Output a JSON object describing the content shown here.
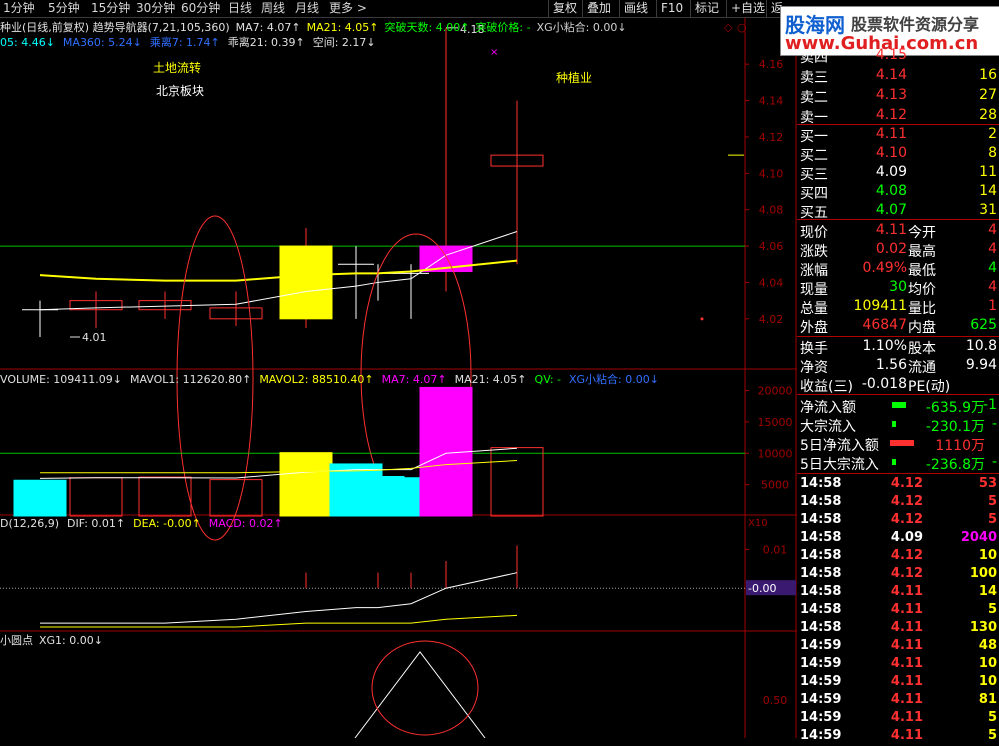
{
  "toolbar": {
    "periods": [
      "1分钟",
      "5分钟",
      "15分钟",
      "30分钟",
      "60分钟",
      "日线",
      "周线",
      "月线",
      "更多 >"
    ],
    "right_buttons": [
      "复权",
      "叠加",
      "画线",
      "F10",
      "标记",
      "+自选",
      "返"
    ]
  },
  "watermark": {
    "title": "股海网",
    "subtitle": "股票软件资源分享",
    "url": "www.Guhai.com.cn"
  },
  "kline": {
    "info_line1": [
      {
        "text": "种业(日线,前复权) 趋势导航器(7,21,105,360)",
        "color": "#e0e0e0"
      },
      {
        "text": "MA7: 4.07↑",
        "color": "#e0e0e0"
      },
      {
        "text": "MA21: 4.05↑",
        "color": "#ffff00"
      },
      {
        "text": "突破天数: 4.00↑",
        "color": "#00ff00"
      },
      {
        "text": "突破价格: -",
        "color": "#00ff00"
      },
      {
        "text": "XG小粘合: 0.00↓",
        "color": "#d0d0d0"
      }
    ],
    "info_line2": [
      {
        "text": "05: 4.46↓",
        "color": "#00ffff"
      },
      {
        "text": "MA360: 5.24↓",
        "color": "#3070ff"
      },
      {
        "text": "乘离7: 1.74↑",
        "color": "#3070ff"
      },
      {
        "text": "乖离21: 0.39↑",
        "color": "#e0e0e0"
      },
      {
        "text": "空间: 2.17↓",
        "color": "#e0e0e0"
      }
    ],
    "annotations": [
      {
        "text": "土地流转",
        "color": "#ffff00"
      },
      {
        "text": "北京板块",
        "color": "#ffffff"
      },
      {
        "text": "种植业",
        "color": "#ffff00"
      }
    ],
    "high_label": "4.18",
    "low_label": "4.01",
    "axis_ticks": [
      "4.16",
      "4.14",
      "4.12",
      "4.10",
      "4.08",
      "4.06",
      "4.04",
      "4.02"
    ]
  },
  "volume": {
    "info": [
      {
        "text": "VOLUME: 109411.09↓",
        "color": "#e0e0e0"
      },
      {
        "text": "MAVOL1: 112620.80↑",
        "color": "#e0e0e0"
      },
      {
        "text": "MAVOL2: 88510.40↑",
        "color": "#ffff00"
      },
      {
        "text": "MA7: 4.07↑",
        "color": "#ff00ff"
      },
      {
        "text": "MA21: 4.05↑",
        "color": "#e0e0e0"
      },
      {
        "text": "QV: -",
        "color": "#00ff00"
      },
      {
        "text": "XG小粘合: 0.00↓",
        "color": "#3070ff"
      }
    ],
    "axis_ticks": [
      "20000",
      "15000",
      "10000",
      "5000"
    ],
    "unit": "X10"
  },
  "macd": {
    "info": [
      {
        "text": "D(12,26,9)",
        "color": "#e0e0e0"
      },
      {
        "text": "DIF: 0.01↑",
        "color": "#e0e0e0"
      },
      {
        "text": "DEA: -0.00↑",
        "color": "#ffff00"
      },
      {
        "text": "MACD: 0.02↑",
        "color": "#ff00ff"
      }
    ],
    "axis_tick": "0.01",
    "current": "-0.00"
  },
  "xg": {
    "info": [
      {
        "text": "小圆点",
        "color": "#e0e0e0"
      },
      {
        "text": "XG1: 0.00↓",
        "color": "#e0e0e0"
      }
    ],
    "axis_tick": "0.50"
  },
  "quote": {
    "sell": [
      {
        "label": "卖四",
        "price": "4.15",
        "vol": ""
      },
      {
        "label": "卖三",
        "price": "4.14",
        "vol": "16"
      },
      {
        "label": "卖二",
        "price": "4.13",
        "vol": "27"
      },
      {
        "label": "卖一",
        "price": "4.12",
        "vol": "28"
      }
    ],
    "buy": [
      {
        "label": "买一",
        "price": "4.11",
        "pcolor": "#ff3030",
        "vol": "2"
      },
      {
        "label": "买二",
        "price": "4.10",
        "pcolor": "#ff3030",
        "vol": "8"
      },
      {
        "label": "买三",
        "price": "4.09",
        "pcolor": "#ffffff",
        "vol": "11"
      },
      {
        "label": "买四",
        "price": "4.08",
        "pcolor": "#00ff00",
        "vol": "14"
      },
      {
        "label": "买五",
        "price": "4.07",
        "pcolor": "#00ff00",
        "vol": "31"
      }
    ],
    "stats": [
      {
        "l1": "现价",
        "v1": "4.11",
        "c1": "#ff3030",
        "l2": "今开",
        "v2": "4",
        "c2": "#ff3030"
      },
      {
        "l1": "涨跌",
        "v1": "0.02",
        "c1": "#ff3030",
        "l2": "最高",
        "v2": "4",
        "c2": "#ff3030"
      },
      {
        "l1": "涨幅",
        "v1": "0.49%",
        "c1": "#ff3030",
        "l2": "最低",
        "v2": "4",
        "c2": "#00ff00"
      },
      {
        "l1": "现量",
        "v1": "30",
        "c1": "#00ff00",
        "l2": "均价",
        "v2": "4",
        "c2": "#ff3030"
      },
      {
        "l1": "总量",
        "v1": "109411",
        "c1": "#ffff00",
        "l2": "量比",
        "v2": "1",
        "c2": "#ff3030"
      },
      {
        "l1": "外盘",
        "v1": "46847",
        "c1": "#ff3030",
        "l2": "内盘",
        "v2": "625",
        "c2": "#00ff00"
      }
    ],
    "stats2": [
      {
        "l1": "换手",
        "v1": "1.10%",
        "l2": "股本",
        "v2": "10.8"
      },
      {
        "l1": "净资",
        "v1": "1.56",
        "l2": "流通",
        "v2": "9.94"
      },
      {
        "l1": "收益(三)",
        "v1": "-0.018",
        "l2": "PE(动)",
        "v2": ""
      }
    ],
    "flow": [
      {
        "label": "净流入额",
        "bar": "#00ff00",
        "value": "-635.9万",
        "vcolor": "#00ff00",
        "extra": "-1"
      },
      {
        "label": "大宗流入",
        "bar": "#00ff00",
        "value": "-230.1万",
        "vcolor": "#00ff00",
        "extra": "-"
      },
      {
        "label": "5日净流入额",
        "bar": "#ff3030",
        "value": "1110万",
        "vcolor": "#ff3030",
        "extra": ""
      },
      {
        "label": "5日大宗流入",
        "bar": "#00ff00",
        "value": "-236.8万",
        "vcolor": "#00ff00",
        "extra": "-"
      }
    ],
    "ticks": [
      {
        "t": "14:58",
        "p": "4.12",
        "pc": "#ff3030",
        "v": "53",
        "vc": "#ff3030"
      },
      {
        "t": "14:58",
        "p": "4.12",
        "pc": "#ff3030",
        "v": "5",
        "vc": "#ff3030"
      },
      {
        "t": "14:58",
        "p": "4.12",
        "pc": "#ff3030",
        "v": "5",
        "vc": "#ff3030"
      },
      {
        "t": "14:58",
        "p": "4.09",
        "pc": "#ffffff",
        "v": "2040",
        "vc": "#ff00ff"
      },
      {
        "t": "14:58",
        "p": "4.12",
        "pc": "#ff3030",
        "v": "10",
        "vc": "#ffff00"
      },
      {
        "t": "14:58",
        "p": "4.12",
        "pc": "#ff3030",
        "v": "100",
        "vc": "#ffff00"
      },
      {
        "t": "14:58",
        "p": "4.11",
        "pc": "#ff3030",
        "v": "14",
        "vc": "#ffff00"
      },
      {
        "t": "14:58",
        "p": "4.11",
        "pc": "#ff3030",
        "v": "5",
        "vc": "#ffff00"
      },
      {
        "t": "14:58",
        "p": "4.11",
        "pc": "#ff3030",
        "v": "130",
        "vc": "#ffff00"
      },
      {
        "t": "14:59",
        "p": "4.11",
        "pc": "#ff3030",
        "v": "48",
        "vc": "#ffff00"
      },
      {
        "t": "14:59",
        "p": "4.11",
        "pc": "#ff3030",
        "v": "10",
        "vc": "#ffff00"
      },
      {
        "t": "14:59",
        "p": "4.11",
        "pc": "#ff3030",
        "v": "10",
        "vc": "#ffff00"
      },
      {
        "t": "14:59",
        "p": "4.11",
        "pc": "#ff3030",
        "v": "81",
        "vc": "#ffff00"
      },
      {
        "t": "14:59",
        "p": "4.11",
        "pc": "#ff3030",
        "v": "5",
        "vc": "#ffff00"
      },
      {
        "t": "14:59",
        "p": "4.11",
        "pc": "#ff3030",
        "v": "5",
        "vc": "#ffff00"
      }
    ]
  },
  "chart_data": {
    "type": "candlestick",
    "ylim": [
      4.01,
      4.17
    ],
    "candles": [
      {
        "open": 4.025,
        "close": 4.025,
        "high": 4.03,
        "low": 4.01,
        "vol": 5700,
        "color": "cyan"
      },
      {
        "open": 4.03,
        "close": 4.025,
        "high": 4.035,
        "low": 4.015,
        "vol": 6100,
        "color": "red"
      },
      {
        "open": 4.025,
        "close": 4.03,
        "high": 4.035,
        "low": 4.02,
        "vol": 6200,
        "color": "red"
      },
      {
        "open": 4.02,
        "close": 4.026,
        "high": 4.035,
        "low": 4.016,
        "vol": 5800,
        "color": "red"
      },
      {
        "open": 4.02,
        "close": 4.06,
        "high": 4.07,
        "low": 4.015,
        "vol": 10100,
        "color": "yellow"
      },
      {
        "open": 4.05,
        "close": 4.05,
        "high": 4.06,
        "low": 4.02,
        "vol": 8300,
        "color": "cyan"
      },
      {
        "open": 4.045,
        "close": 4.045,
        "high": 4.05,
        "low": 4.03,
        "vol": 6300,
        "color": "cyan"
      },
      {
        "open": 4.04,
        "close": 4.045,
        "high": 4.05,
        "low": 4.02,
        "vol": 6100,
        "color": "cyan"
      },
      {
        "open": 4.046,
        "close": 4.06,
        "high": 4.18,
        "low": 4.035,
        "vol": 20500,
        "color": "magenta"
      },
      {
        "open": 4.11,
        "close": 4.104,
        "high": 4.14,
        "low": 4.05,
        "vol": 10900,
        "color": "red"
      }
    ],
    "ma7": [
      4.025,
      4.026,
      4.027,
      4.028,
      4.035,
      4.038,
      4.04,
      4.042,
      4.055,
      4.068
    ],
    "ma21": [
      4.044,
      4.042,
      4.041,
      4.041,
      4.044,
      4.045,
      4.045,
      4.046,
      4.048,
      4.052
    ],
    "hline": 4.06,
    "vol_ylim": [
      0,
      22000
    ],
    "mavol1": [
      6000,
      6100,
      6100,
      6050,
      7000,
      7400,
      7400,
      7400,
      10000,
      10800
    ],
    "mavol2": [
      6900,
      6900,
      6900,
      6900,
      7100,
      7200,
      7300,
      7600,
      8200,
      8850
    ],
    "vol_hline": 10000,
    "macd_bars": [
      0.0,
      0.0,
      0.0,
      0.0,
      0.004,
      0.0,
      0.004,
      0.004,
      0.007,
      0.011
    ],
    "dif": [
      -0.009,
      -0.009,
      -0.009,
      -0.008,
      -0.006,
      -0.005,
      -0.005,
      -0.004,
      0.0,
      0.004
    ],
    "dea": [
      -0.01,
      -0.01,
      -0.01,
      -0.01,
      -0.009,
      -0.009,
      -0.009,
      -0.009,
      -0.008,
      -0.007
    ],
    "macd_ylim": [
      -0.01,
      0.015
    ]
  }
}
